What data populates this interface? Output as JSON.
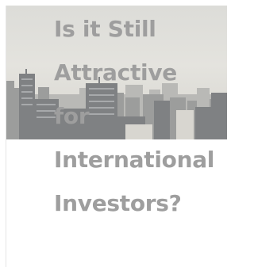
{
  "article": {
    "title_lines": [
      "Is it Still",
      "Attractive",
      "for",
      "International",
      "Investors?"
    ]
  },
  "hero": {
    "icon": "city-skyline-photo",
    "sky_color": "#dedcd7",
    "building_color": "#8d8f91"
  }
}
